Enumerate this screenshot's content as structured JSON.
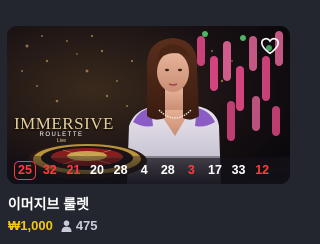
{
  "game": {
    "title": "이머지브 룰렛",
    "min_bet": "₩1,000",
    "players": "475",
    "logo_main": "IMMERSIVE",
    "logo_sub": "ROULETTE",
    "logo_sub2": "Live",
    "favorite_icon": "heart-outline-icon",
    "players_icon": "person-icon"
  },
  "results": [
    {
      "value": "25",
      "color": "red"
    },
    {
      "value": "32",
      "color": "red"
    },
    {
      "value": "21",
      "color": "red"
    },
    {
      "value": "20",
      "color": "white"
    },
    {
      "value": "28",
      "color": "white"
    },
    {
      "value": "4",
      "color": "white"
    },
    {
      "value": "28",
      "color": "white"
    },
    {
      "value": "3",
      "color": "red"
    },
    {
      "value": "17",
      "color": "white"
    },
    {
      "value": "33",
      "color": "white"
    },
    {
      "value": "12",
      "color": "red"
    }
  ],
  "colors": {
    "background": "#23252f",
    "red": "#ff3b3b",
    "gold": "#f5c518",
    "logo_gold": "#e6cf9a"
  }
}
